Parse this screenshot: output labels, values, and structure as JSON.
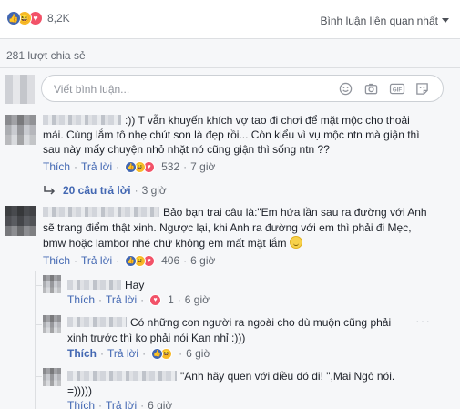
{
  "header": {
    "reaction_count": "8,2K",
    "sort_label": "Bình luận liên quan nhất",
    "shares_label": "281 lượt chia sẻ"
  },
  "composer": {
    "placeholder": "Viết bình luận...",
    "icons": [
      "emoji-icon",
      "camera-icon",
      "gif-icon",
      "sticker-icon"
    ]
  },
  "comments": [
    {
      "text_line1": ":)) T vẫn khuyến khích vợ tao đi chơi để mặt mộc cho thoải",
      "text_line2": "mái. Cùng lắm tô nhẹ chút son là đẹp rồi... Còn kiểu vì vụ mộc ntn mà giận thì",
      "text_line3": "sau này mấy chuyện nhỏ nhặt nó cũng giận thì sống ntn ??",
      "like": "Thích",
      "reply": "Trả lời",
      "reactions": "532",
      "time": "7 giờ",
      "replies_link": "20 câu trả lời",
      "replies_time": "3 giờ"
    },
    {
      "text_line1": "Bảo bạn trai câu là:\"Em hứa lần sau ra đường với Anh",
      "text_line2": "sẽ trang điểm thật xinh. Ngược lại, khi Anh ra đường với em thì phải đi Mẹc,",
      "text_line3": "bmw hoặc lambor nhé chứ không em mất mặt lắm",
      "like": "Thích",
      "reply": "Trả lời",
      "reactions": "406",
      "time": "6 giờ"
    }
  ],
  "replies": [
    {
      "text": "Hay",
      "like": "Thích",
      "reply": "Trả lời",
      "reactions": "1",
      "time": "6 giờ"
    },
    {
      "text_line1": "Có những con người ra ngoài cho dù muộn cũng phải",
      "text_line2": "xinh trước thì ko phải nói Kan nhỉ :)))",
      "like": "Thích",
      "reply": "Trả lời",
      "time": "6 giờ"
    },
    {
      "text_line1": "\"Anh hãy quen với điều đó đi! \",Mai Ngô nói.",
      "text_line2": "=)))))",
      "like": "Thích",
      "reply": "Trả lời",
      "time": "6 giờ"
    }
  ],
  "colors": {
    "link": "#4267b2",
    "meta": "#616770",
    "like": "#4267b2",
    "haha": "#f7b928",
    "love": "#f25268"
  }
}
